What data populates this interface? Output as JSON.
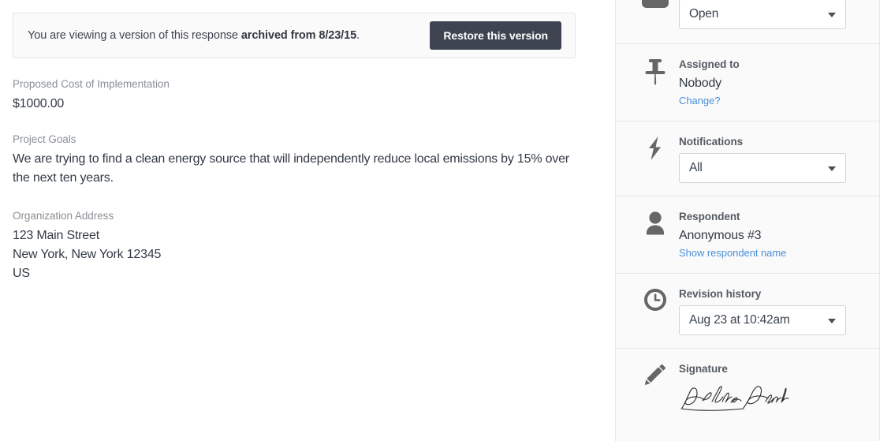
{
  "banner": {
    "text_prefix": "You are viewing a version of this response ",
    "text_bold": "archived from 8/23/15",
    "text_suffix": ".",
    "restore_label": "Restore this version",
    "button_color": "#3e4450",
    "background": "#fafafa"
  },
  "response_fields": [
    {
      "label": "Proposed Cost of Implementation",
      "value": "$1000.00"
    },
    {
      "label": "Project Goals",
      "value": "We are trying to find a clean energy source that will independently reduce local emissions by 15% over the next ten years."
    },
    {
      "label": "Organization Address",
      "value_lines": [
        "123 Main Street",
        "New York, New York 12345",
        "US"
      ]
    }
  ],
  "sidebar": {
    "status": {
      "icon": "tag-icon",
      "selected": "Open"
    },
    "assigned": {
      "icon": "pushpin-icon",
      "title": "Assigned to",
      "value": "Nobody",
      "link": "Change?"
    },
    "notifications": {
      "icon": "lightning-bolt-icon",
      "title": "Notifications",
      "selected": "All"
    },
    "respondent": {
      "icon": "person-icon",
      "title": "Respondent",
      "value": "Anonymous #3",
      "link": "Show respondent name"
    },
    "revision": {
      "icon": "clock-icon",
      "title": "Revision history",
      "selected": "Aug 23 at 10:42am"
    },
    "signature": {
      "icon": "pencil-icon",
      "title": "Signature",
      "value": "Debra Granik"
    }
  },
  "colors": {
    "link": "#4a90d9",
    "text": "#333a45",
    "muted": "#8a8f96",
    "panel_bg": "#fafafa",
    "border": "#e6e6e6"
  }
}
